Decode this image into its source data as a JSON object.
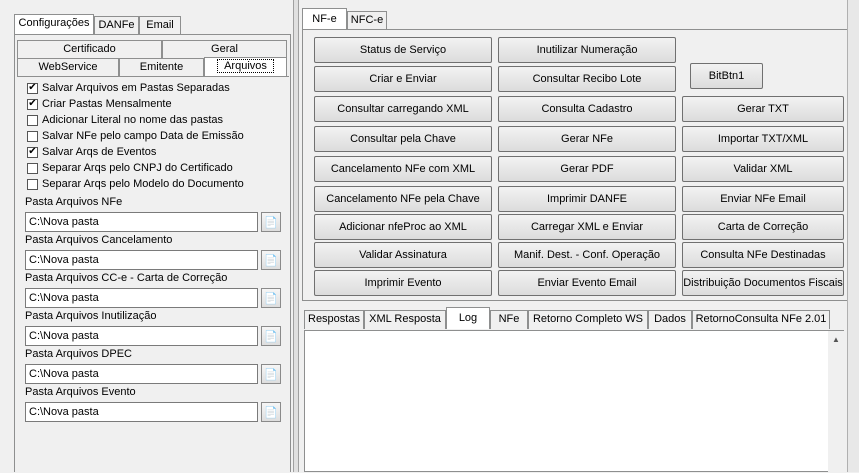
{
  "left_tabs": [
    "Configurações",
    "DANFe",
    "Email"
  ],
  "sub_tabs_row1": [
    "Certificado",
    "Geral"
  ],
  "sub_tabs_row2": [
    "WebService",
    "Emitente",
    "Arquivos"
  ],
  "checkboxes": [
    {
      "label": "Salvar Arquivos em Pastas Separadas",
      "checked": true
    },
    {
      "label": "Criar Pastas Mensalmente",
      "checked": true
    },
    {
      "label": "Adicionar Literal no nome das pastas",
      "checked": false
    },
    {
      "label": "Salvar NFe pelo campo Data de Emissão",
      "checked": false
    },
    {
      "label": "Salvar Arqs de Eventos",
      "checked": true
    },
    {
      "label": "Separar Arqs pelo CNPJ do Certificado",
      "checked": false
    },
    {
      "label": "Separar Arqs pelo Modelo do Documento",
      "checked": false
    }
  ],
  "folders": [
    {
      "label": "Pasta Arquivos NFe",
      "value": "C:\\Nova pasta"
    },
    {
      "label": "Pasta Arquivos Cancelamento",
      "value": "C:\\Nova pasta"
    },
    {
      "label": "Pasta Arquivos CC-e - Carta de Correção",
      "value": "C:\\Nova pasta"
    },
    {
      "label": "Pasta Arquivos Inutilização",
      "value": "C:\\Nova pasta"
    },
    {
      "label": "Pasta Arquivos DPEC",
      "value": "C:\\Nova pasta"
    },
    {
      "label": "Pasta Arquivos Evento",
      "value": "C:\\Nova pasta"
    }
  ],
  "right_tabs": [
    "NF-e",
    "NFC-e"
  ],
  "buttons": {
    "col1": [
      "Status de Serviço",
      "Criar e Enviar",
      "Consultar carregando XML",
      "Consultar pela Chave",
      "Cancelamento NFe com XML",
      "Cancelamento NFe pela Chave",
      "Adicionar nfeProc ao XML",
      "Validar Assinatura",
      "Imprimir Evento"
    ],
    "col2": [
      "Inutilizar Numeração",
      "Consultar Recibo Lote",
      "Consulta Cadastro",
      "Gerar NFe",
      "Gerar PDF",
      "Imprimir DANFE",
      "Carregar XML e Enviar",
      "Manif. Dest. - Conf. Operação",
      "Enviar Evento Email"
    ],
    "col3": [
      "Gerar TXT",
      "Importar TXT/XML",
      "Validar XML",
      "Enviar NFe Email",
      "Carta de Correção",
      "Consulta NFe Destinadas",
      "Distribuição Documentos Fiscais"
    ],
    "bitbtn": "BitBtn1"
  },
  "bottom_tabs": [
    "Respostas",
    "XML Resposta",
    "Log",
    "NFe",
    "Retorno Completo WS",
    "Dados",
    "RetornoConsulta NFe 2.01"
  ]
}
